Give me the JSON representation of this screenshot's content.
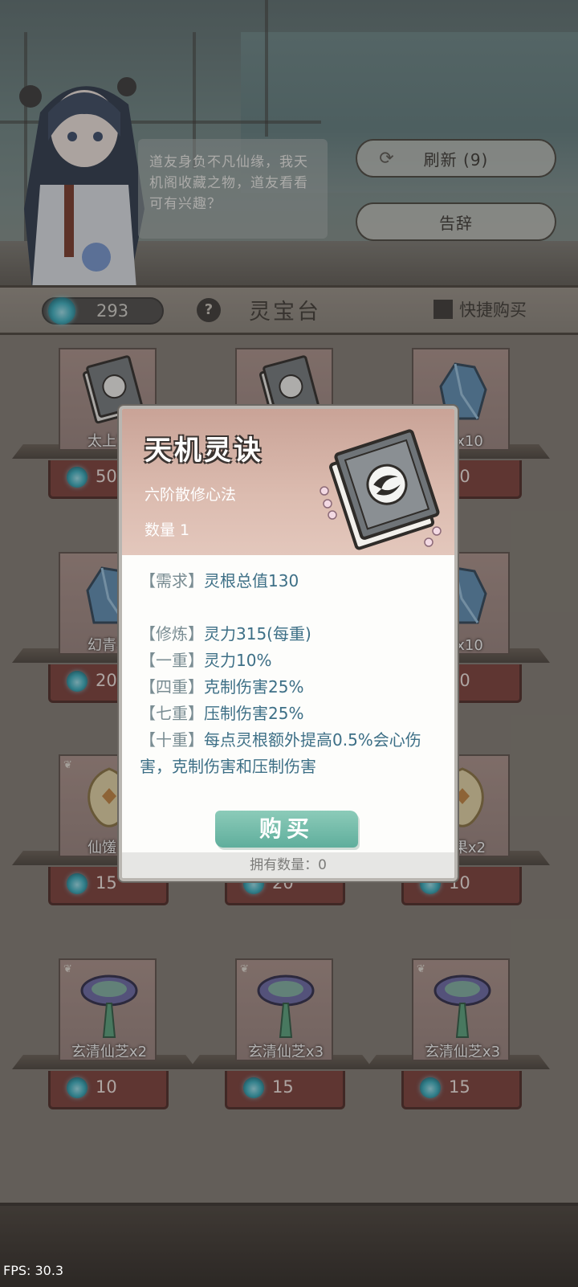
{
  "npc": {
    "dialogue": "道友身负不凡仙缘，我天机阁收藏之物，道友看看可有兴趣？"
  },
  "actions": {
    "refresh_label": "刷新 (9)",
    "leave_label": "告辞"
  },
  "header": {
    "currency_amount": "293",
    "help_symbol": "?",
    "title": "灵宝台",
    "quick_buy_label": "快捷购买"
  },
  "shop_items": [
    {
      "name": "太上忘",
      "price": "50",
      "art": "book"
    },
    {
      "name": "天机灵诀",
      "price": "",
      "art": "book"
    },
    {
      "name": "石x10",
      "price": "20",
      "art": "crystal"
    },
    {
      "name": "幻青石",
      "price": "20",
      "art": "crystal"
    },
    {
      "name": "",
      "price": "",
      "art": "none"
    },
    {
      "name": "石x10",
      "price": "20",
      "art": "crystal"
    },
    {
      "name": "仙馐果",
      "price": "15",
      "art": "fruit"
    },
    {
      "name": "",
      "price": "20",
      "art": "none"
    },
    {
      "name": "馐果x2",
      "price": "10",
      "art": "fruit"
    },
    {
      "name": "玄清仙芝x2",
      "price": "10",
      "art": "mushroom"
    },
    {
      "name": "玄清仙芝x3",
      "price": "15",
      "art": "mushroom"
    },
    {
      "name": "玄清仙芝x3",
      "price": "15",
      "art": "mushroom"
    }
  ],
  "modal": {
    "title": "天机灵诀",
    "subtitle": "六阶散修心法",
    "quantity": "数量 1",
    "requirement_tag": "【需求】",
    "requirement": "灵根总值130",
    "lines": [
      {
        "tag": "【修炼】",
        "text": "灵力315(每重)"
      },
      {
        "tag": "【一重】",
        "text": "灵力10%"
      },
      {
        "tag": "【四重】",
        "text": "克制伤害25%"
      },
      {
        "tag": "【七重】",
        "text": "压制伤害25%"
      }
    ],
    "tenth_tag": "【十重】",
    "tenth_text": "每点灵根额外提高0.5%会心伤害，克制伤害和压制伤害",
    "buy_label": "购买",
    "owned_label": "拥有数量：0"
  },
  "debug": {
    "fps": "FPS: 30.3"
  },
  "colors": {
    "modal_text": "#3d6f86",
    "buy_button": "#6fb8a6",
    "price_box": "#7d3f3a"
  }
}
